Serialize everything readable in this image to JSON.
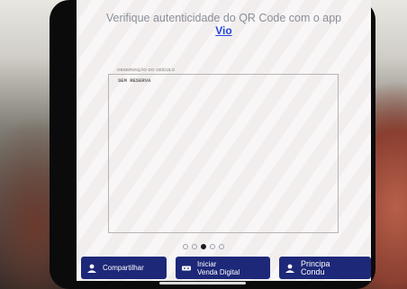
{
  "header": {
    "message": "Verifique autenticidade do QR Code com o app",
    "link": "Vio"
  },
  "observation": {
    "label": "OBSERVAÇÃO DO VEÍCULO",
    "value": "SEM RESERVA"
  },
  "pager": {
    "count": 5,
    "active_index": 2
  },
  "buttons": {
    "share_label": "Compartilhar",
    "start_sale_label_line1": "Iniciar",
    "start_sale_label_line2": "Venda Digital",
    "main_driver_label_line1": "Principa",
    "main_driver_label_line2": "Condu"
  },
  "colors": {
    "screen_bg": "#f3eeee",
    "button_bg": "#1d2878",
    "link": "#2546d8",
    "header_text": "#8a8f99"
  }
}
